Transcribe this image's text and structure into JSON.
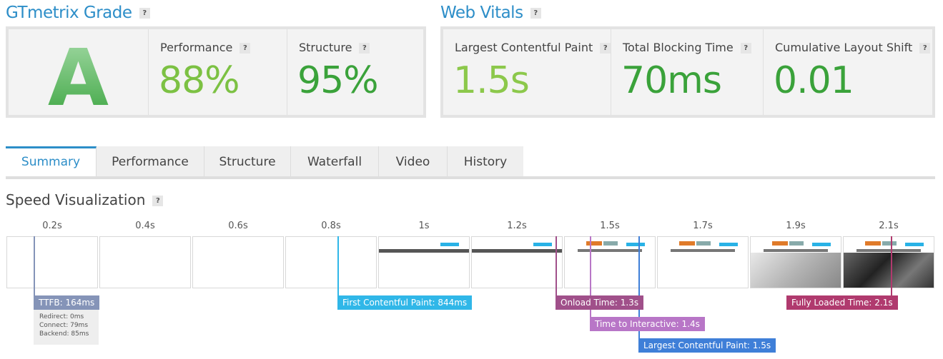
{
  "gtmetrix": {
    "title": "GTmetrix Grade",
    "help": "?",
    "grade": "A",
    "performance": {
      "label": "Performance",
      "value": "88%",
      "color": "#7cc143"
    },
    "structure": {
      "label": "Structure",
      "value": "95%",
      "color": "#3aa23a"
    }
  },
  "web_vitals": {
    "title": "Web Vitals",
    "help": "?",
    "lcp": {
      "label": "Largest Contentful Paint",
      "value": "1.5s",
      "color": "#8cc84b"
    },
    "tbt": {
      "label": "Total Blocking Time",
      "value": "70ms",
      "color": "#3aa23a"
    },
    "cls": {
      "label": "Cumulative Layout Shift",
      "value": "0.01",
      "color": "#3aa23a"
    }
  },
  "tabs": [
    "Summary",
    "Performance",
    "Structure",
    "Waterfall",
    "Video",
    "History"
  ],
  "active_tab": "Summary",
  "speed_visualization": {
    "title": "Speed Visualization",
    "help": "?",
    "times": [
      "0.2s",
      "0.4s",
      "0.6s",
      "0.8s",
      "1s",
      "1.2s",
      "1.5s",
      "1.7s",
      "1.9s",
      "2.1s"
    ],
    "markers": {
      "ttfb": {
        "label": "TTFB: 164ms",
        "color": "#8594b8"
      },
      "fcp": {
        "label": "First Contentful Paint: 844ms",
        "color": "#30b7e8"
      },
      "onload": {
        "label": "Onload Time: 1.3s",
        "color": "#a0508a"
      },
      "tti": {
        "label": "Time to Interactive: 1.4s",
        "color": "#b876c7"
      },
      "lcp": {
        "label": "Largest Contentful Paint: 1.5s",
        "color": "#3f7fd8"
      },
      "fully_loaded": {
        "label": "Fully Loaded Time: 2.1s",
        "color": "#b03a6e"
      }
    },
    "ttfb_details": {
      "redirect": "Redirect: 0ms",
      "connect": "Connect: 79ms",
      "backend": "Backend: 85ms"
    }
  }
}
